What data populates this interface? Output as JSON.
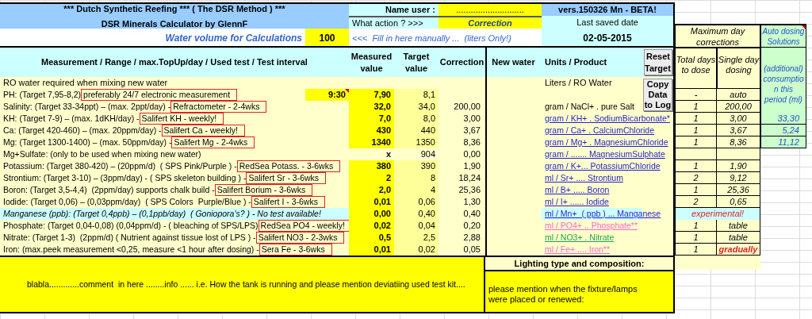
{
  "title": {
    "line1": "***  Dutch Synthetic Reefing  ***  ( The DSR Method )  ***",
    "line2": "DSR Minerals Calculator by GlennF"
  },
  "name_user": {
    "label": "Name user :",
    "value": "............................"
  },
  "version": "vers.150326 Mn - BETA!",
  "action": {
    "label": "What action ? >>>",
    "value": "Correction"
  },
  "last_saved": {
    "label": "Last saved date",
    "value": "02-05-2015"
  },
  "water_volume": {
    "label": "Water volume for Calculations",
    "value": "100",
    "hint": "<<<  Fill in here manually ...  (liters Only!)"
  },
  "columns": [
    "Measurement / Range / max.TopUp/day  / Used test / Test interval",
    "Measured value",
    "Target value",
    "Correction",
    "New water",
    "Units /  Product"
  ],
  "buttons": [
    "Reset Target",
    "Copy Data to Log"
  ],
  "max_day": {
    "title": "Maximum day corrections",
    "columns": [
      "Total days to dose",
      "Single day dosing"
    ]
  },
  "auto_dosing": {
    "title": "Auto dosing Solutions",
    "subtitle": "(additional) consumptio n this period (ml)"
  },
  "ro_row": {
    "label": "RO water required when mixing new water",
    "unit": "Liters / RO Water"
  },
  "rows": [
    {
      "kind": "normal",
      "label": "PH: (Target 7,95-8,2)",
      "test": "preferably 24/7 electronic measurement",
      "time": "9:30",
      "measured": "7,90",
      "target": "8,1",
      "days": "-",
      "single": "auto",
      "alert": false
    },
    {
      "kind": "normal",
      "label": "Salinity: (Target 33-34ppt) – (max. 2ppt/day) -",
      "test": "Refractometer - 2-4wks",
      "measured": "32,0",
      "target": "34,0",
      "correction": "200,00",
      "unit": {
        "text": "gram / NaCl+ . pure Salt",
        "link": false
      },
      "days": "1",
      "single": "200,00",
      "alert": false
    },
    {
      "kind": "normal",
      "label": "KH: (Target 7-9) – (max. 1dKH/day) -",
      "test": "Salifert KH - weekly!",
      "measured": "7,0",
      "target": "8,0",
      "correction": "3,00",
      "unit": {
        "text": "gram / KH+ . SodiumBicarbonate*",
        "link": true,
        "color": "#1f1fd1"
      },
      "days": "1",
      "single": "3,00",
      "auto": "33,30",
      "alert": false
    },
    {
      "kind": "normal",
      "label": "Ca: (Target 420-460) – (max. 20ppm/day) -",
      "test": "Salifert Ca - weekly!",
      "measured": "430",
      "target": "440",
      "correction": "3,67",
      "unit": {
        "text": "gram / Ca+ . CalciumChloride",
        "link": true,
        "color": "#1f1fd1"
      },
      "days": "1",
      "single": "3,67",
      "auto": "5,24",
      "alert": false
    },
    {
      "kind": "normal",
      "label": "Mg: (Target 1300-1400) – (max. 50ppm/day) -",
      "test": "Salifert Mg - 2-4wks",
      "measured": "1340",
      "target": "1350",
      "correction": "8,36",
      "unit": {
        "text": "gram / Mg+ . MagnesiumChloride",
        "link": true,
        "color": "#1f1fd1"
      },
      "days": "1",
      "single": "8,36",
      "auto": "11,12",
      "alert": false
    },
    {
      "kind": "mixing",
      "label": "Mg+Sulfate: (only to be used when mixing new water)",
      "measured": "x",
      "target": "904",
      "correction": "0,00",
      "unit": {
        "text": "gram / ....... MagnesiumSulphate",
        "link": true,
        "color": "#1f1fd1"
      }
    },
    {
      "kind": "normal",
      "label": "Potassium: (Target 380-420) – (20ppm/d)  ( SPS Pink/Purple ) -",
      "test": "RedSea Potass. - 3-6wks",
      "measured": "380",
      "target": "390",
      "correction": "1,90",
      "unit": {
        "text": "gram / K+... PotassiumChloride",
        "link": true,
        "color": "#1f1fd1"
      },
      "days": "1",
      "single": "1,90",
      "alert": false
    },
    {
      "kind": "normal",
      "label": "Strontium: (Target 3-10) – (3ppm/day) - ( SPS skeleton building ) -",
      "test": "Salifert Sr - 3-6wks",
      "measured": "2",
      "target": "8",
      "correction": "18,24",
      "unit": {
        "text": "ml / Sr+ .... Strontium",
        "link": true,
        "color": "#1f1fd1"
      },
      "days": "2",
      "single": "9,12",
      "alert": false
    },
    {
      "kind": "normal",
      "label": "Boron: (Target 3,5-4,4)  (2ppm/day) supports chalk build -",
      "test": "Salifert Borium - 3-6wks",
      "measured": "2,0",
      "target": "4",
      "correction": "25,36",
      "unit": {
        "text": "ml / B+ ..... Boron",
        "link": true,
        "color": "#1f1fd1"
      },
      "days": "1",
      "single": "25,36",
      "alert": false
    },
    {
      "kind": "normal",
      "label": "Iodide: (Target 0,06) – (0,03ppm/day)  ( SPS Colors  Purple/Blue ) -",
      "test": "Salifert I - 3-6wks",
      "measured": "0,01",
      "target": "0,06",
      "correction": "1,30",
      "unit": {
        "text": "ml / I+ ...... Iodide",
        "link": true,
        "color": "#1f1fd1"
      },
      "days": "2",
      "single": "0,65",
      "alert": false
    },
    {
      "kind": "info",
      "label": "Manganese (ppb): (Target 0,4ppb) – (0,1ppb/day)  ( Goniopora's? ) - No test available!",
      "measured": "0,00",
      "target": "0,40",
      "correction": "0,40",
      "unit": {
        "text": "ml / Mn+  ( ppb ) ... Manganese",
        "link": true,
        "color": "#1f1fd1"
      },
      "note": "experimental!"
    },
    {
      "kind": "normal",
      "label": "Phosphate: (Target 0,04-0,08) (0,04ppm/d) - ( bleaching of SPS/LPS)",
      "test": "RedSea PO4 - weekly!",
      "measured": "0,02",
      "target": "0,04",
      "correction": "0,20",
      "unit": {
        "text": "ml / PO4+ .. Phosphate**",
        "link": true,
        "color": "#ff66cc"
      },
      "days": "1",
      "single": "table",
      "alert": false
    },
    {
      "kind": "normal",
      "label": "Nitrate: (Target 1-3)  (2ppm/d) ( Nutrient against tissue lost of LPS ) -",
      "test": "Salifert NO3 - 2-3wks",
      "measured": "0,5",
      "target": "2,5",
      "correction": "2,88",
      "unit": {
        "text": "ml / NO3+ . Nitrate",
        "link": true,
        "color": "#22a050"
      },
      "days": "1",
      "single": "table",
      "alert": false
    },
    {
      "kind": "normal",
      "label": "Iron: (max.peek measurement <0,25, measure <1 hour after dosing) -",
      "test": "Sera Fe - 3-6wks",
      "measured": "0,01",
      "target": "0,02",
      "correction": "0,05",
      "unit": {
        "text": "ml / Fe+ .... Iron**",
        "link": true,
        "color": "#ff66cc"
      },
      "days": "1",
      "single": "gradually",
      "alert": true
    }
  ],
  "comment": "blabla.............comment  in here ........info ...... i.e. How the tank is running and please mention deviatiing used test kit....",
  "lighting": {
    "title": "Lighting type and composition:",
    "value": "please mention when the fixture/lamps were placed or renewed:"
  }
}
